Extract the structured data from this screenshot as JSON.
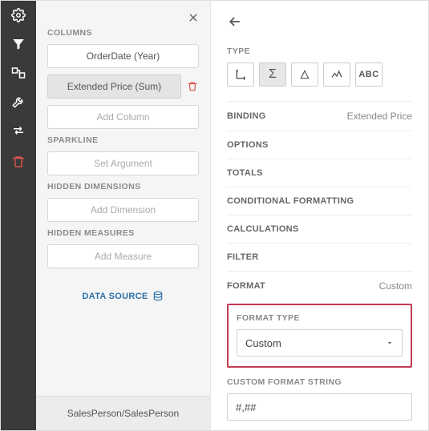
{
  "sidebar": {
    "icons": [
      "gear",
      "filter",
      "layout",
      "wrench",
      "arrows",
      "trash"
    ]
  },
  "mid": {
    "columns_label": "COLUMNS",
    "columns": [
      {
        "label": "OrderDate (Year)",
        "selected": false
      },
      {
        "label": "Extended Price (Sum)",
        "selected": true,
        "removable": true
      }
    ],
    "add_column": "Add Column",
    "sparkline_label": "SPARKLINE",
    "sparkline_placeholder": "Set Argument",
    "hidden_dim_label": "HIDDEN DIMENSIONS",
    "hidden_dim_placeholder": "Add Dimension",
    "hidden_meas_label": "HIDDEN MEASURES",
    "hidden_meas_placeholder": "Add Measure",
    "data_source_label": "DATA SOURCE",
    "footer": "SalesPerson/SalesPerson"
  },
  "right": {
    "type_label": "TYPE",
    "type_buttons": [
      "dimension",
      "sigma",
      "delta",
      "sparkline",
      "abc"
    ],
    "type_selected": 1,
    "props": {
      "binding_label": "BINDING",
      "binding_value": "Extended Price",
      "options_label": "OPTIONS",
      "totals_label": "TOTALS",
      "cond_label": "CONDITIONAL FORMATTING",
      "calc_label": "CALCULATIONS",
      "filter_label": "FILTER",
      "format_label": "FORMAT",
      "format_value": "Custom"
    },
    "format_type_label": "FORMAT TYPE",
    "format_type_value": "Custom",
    "custom_fmt_label": "CUSTOM FORMAT STRING",
    "custom_fmt_value": "#,##"
  }
}
